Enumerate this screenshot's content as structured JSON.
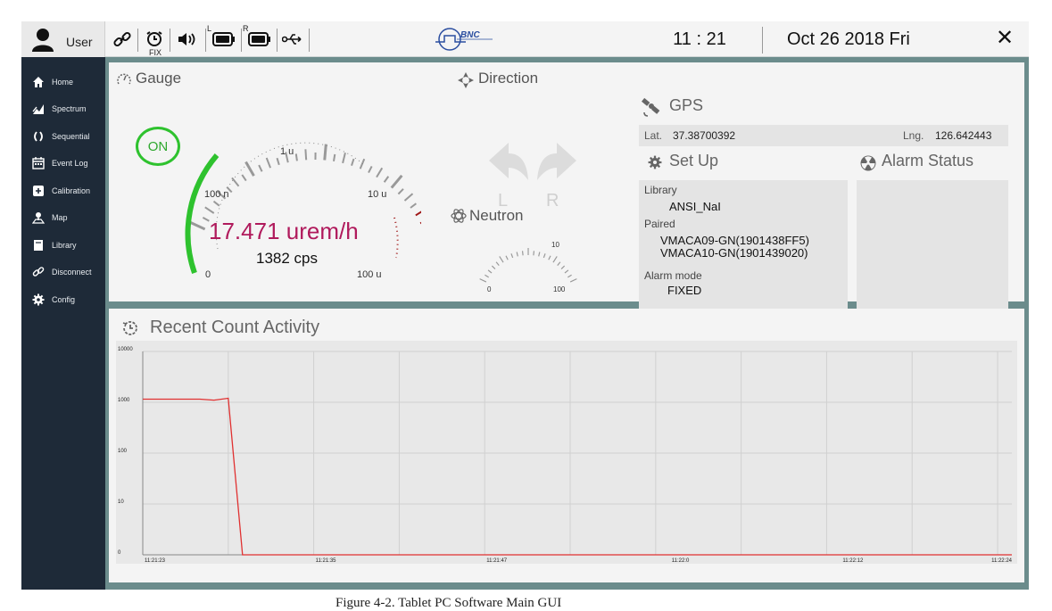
{
  "topbar": {
    "user_label": "User",
    "fix_label": "FIX",
    "battery_left_label": "L",
    "battery_right_label": "R",
    "logo_text": "BNC",
    "time": "11 : 21",
    "date": "Oct 26 2018 Fri",
    "close_symbol": "✕"
  },
  "sidebar": {
    "items": [
      {
        "label": "Home",
        "icon": "home-icon"
      },
      {
        "label": "Spectrum",
        "icon": "spectrum-icon"
      },
      {
        "label": "Sequential",
        "icon": "sequential-icon"
      },
      {
        "label": "Event Log",
        "icon": "calendar-icon"
      },
      {
        "label": "Calibration",
        "icon": "calibration-icon"
      },
      {
        "label": "Map",
        "icon": "map-icon"
      },
      {
        "label": "Library",
        "icon": "library-icon"
      },
      {
        "label": "Disconnect",
        "icon": "link-icon"
      },
      {
        "label": "Config",
        "icon": "gear-icon"
      }
    ]
  },
  "gauge": {
    "title": "Gauge",
    "on_label": "ON",
    "dose_rate": "17.471 urem/h",
    "count_rate": "1382 cps",
    "scale_labels": [
      "0",
      "100 n",
      "1 u",
      "10 u",
      "100 u"
    ],
    "accent_green": "#2ec22e",
    "accent_red": "#a01818"
  },
  "direction": {
    "title": "Direction",
    "left_label": "L",
    "right_label": "R"
  },
  "neutron": {
    "title": "Neutron",
    "scale_labels": [
      "0",
      "10",
      "100"
    ]
  },
  "gps": {
    "title": "GPS",
    "lat_label": "Lat.",
    "lat_value": "37.38700392",
    "lng_label": "Lng.",
    "lng_value": "126.642443"
  },
  "setup": {
    "title": "Set Up",
    "library_label": "Library",
    "library_value": "ANSI_NaI",
    "paired_label": "Paired",
    "paired_values": [
      "VMACA09-GN(1901438FF5)",
      "VMACA10-GN(1901439020)"
    ],
    "alarm_mode_label": "Alarm mode",
    "alarm_mode_value": "FIXED"
  },
  "alarm": {
    "title": "Alarm Status"
  },
  "activity": {
    "title": "Recent Count Activity"
  },
  "chart_data": {
    "type": "line",
    "title": "Recent Count Activity",
    "yscale": "log",
    "ylim": [
      1,
      10000
    ],
    "y_tick_labels": [
      "10000",
      "1000",
      "100",
      "10",
      "0"
    ],
    "x_tick_labels": [
      "11:21:23",
      "11:21:35",
      "11:21:47",
      "11:22:0",
      "11:22:12",
      "11:22:24"
    ],
    "grid": true,
    "series": [
      {
        "color": "#e03030",
        "x": [
          "11:21:23",
          "11:21:27",
          "11:21:28",
          "11:21:29",
          "11:21:30",
          "11:21:31",
          "11:22:24"
        ],
        "y": [
          1150,
          1150,
          1100,
          1200,
          1,
          1,
          1
        ]
      }
    ]
  },
  "caption": "Figure 4-2. Tablet PC Software Main GUI"
}
